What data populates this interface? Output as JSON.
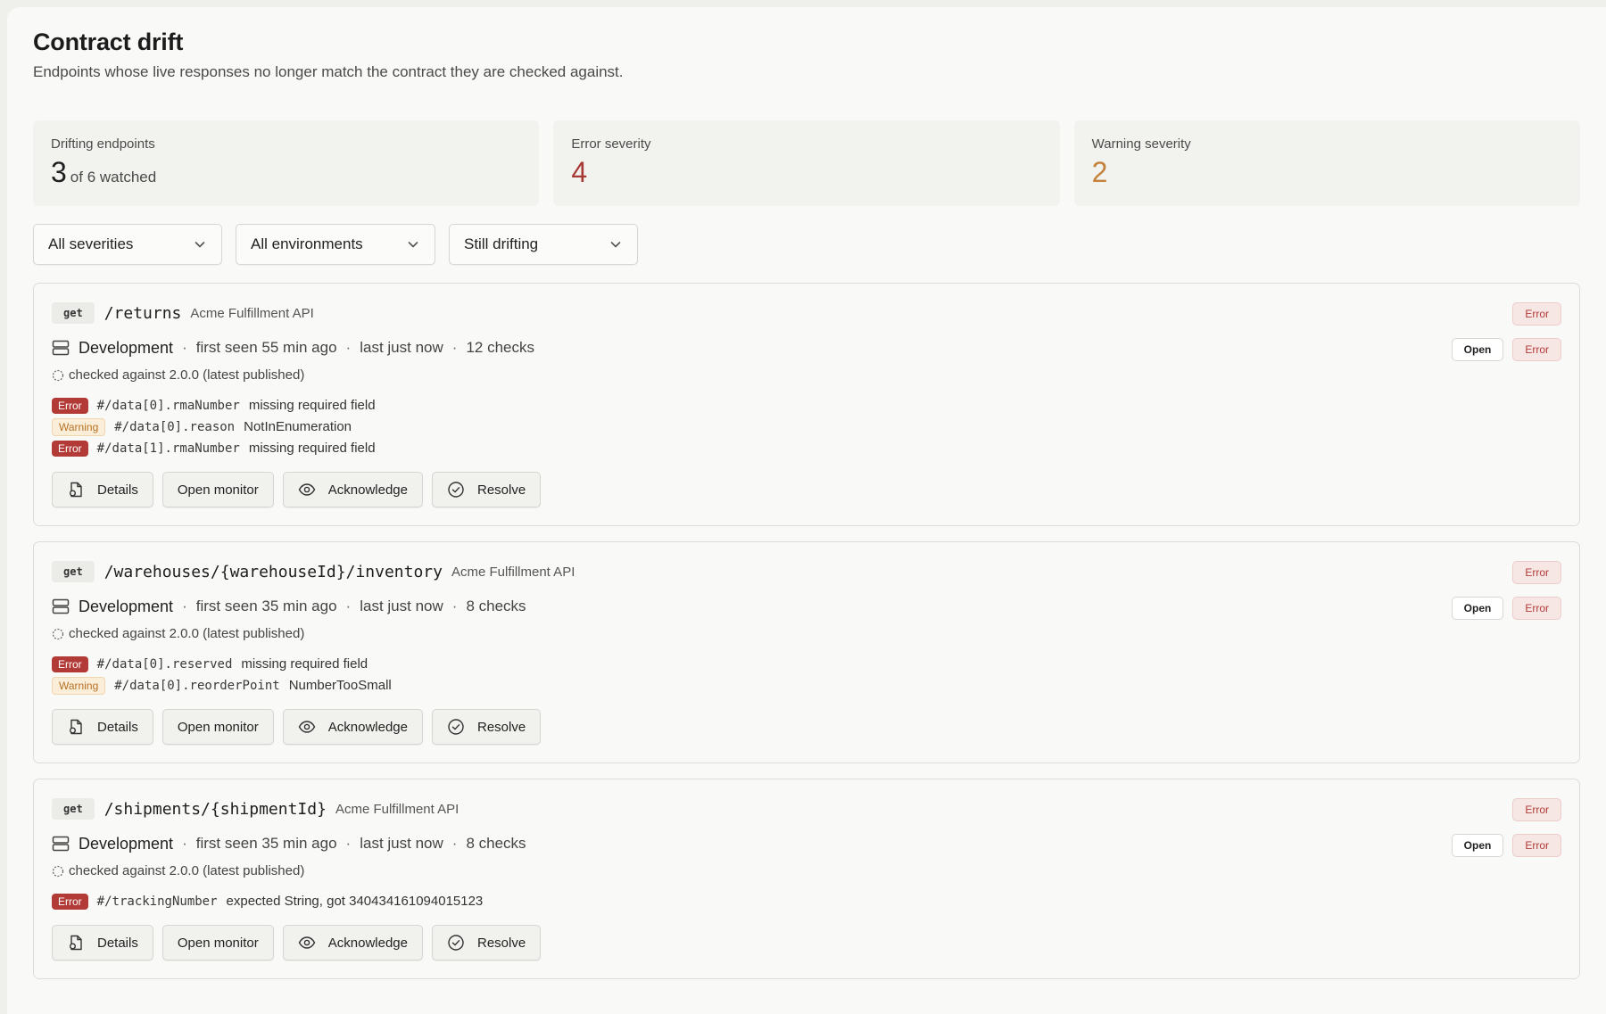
{
  "header": {
    "title": "Contract drift",
    "subtitle": "Endpoints whose live responses no longer match the contract they are checked against."
  },
  "stats": [
    {
      "label": "Drifting endpoints",
      "value": "3",
      "suffix": "of 6 watched",
      "tone": "neutral"
    },
    {
      "label": "Error severity",
      "value": "4",
      "suffix": "",
      "tone": "error"
    },
    {
      "label": "Warning severity",
      "value": "2",
      "suffix": "",
      "tone": "warning"
    }
  ],
  "filters": [
    {
      "selected": "All severities"
    },
    {
      "selected": "All environments"
    },
    {
      "selected": "Still drifting"
    }
  ],
  "actions": {
    "details": "Details",
    "open_monitor": "Open monitor",
    "acknowledge": "Acknowledge",
    "resolve": "Resolve"
  },
  "cards": [
    {
      "method": "get",
      "path": "/returns",
      "api": "Acme Fulfillment API",
      "severity_badge": "Error",
      "status_badge": "Open",
      "status_severity": "Error",
      "environment": "Development",
      "first_seen": "first seen 55 min ago",
      "last_seen": "last just now",
      "checks": "12 checks",
      "checked_against": "checked against 2.0.0 (latest published)",
      "issues": [
        {
          "severity": "Error",
          "pointer": "#/data[0].rmaNumber",
          "message": "missing required field"
        },
        {
          "severity": "Warning",
          "pointer": "#/data[0].reason",
          "message": "NotInEnumeration"
        },
        {
          "severity": "Error",
          "pointer": "#/data[1].rmaNumber",
          "message": "missing required field"
        }
      ]
    },
    {
      "method": "get",
      "path": "/warehouses/{warehouseId}/inventory",
      "api": "Acme Fulfillment API",
      "severity_badge": "Error",
      "status_badge": "Open",
      "status_severity": "Error",
      "environment": "Development",
      "first_seen": "first seen 35 min ago",
      "last_seen": "last just now",
      "checks": "8 checks",
      "checked_against": "checked against 2.0.0 (latest published)",
      "issues": [
        {
          "severity": "Error",
          "pointer": "#/data[0].reserved",
          "message": "missing required field"
        },
        {
          "severity": "Warning",
          "pointer": "#/data[0].reorderPoint",
          "message": "NumberTooSmall"
        }
      ]
    },
    {
      "method": "get",
      "path": "/shipments/{shipmentId}",
      "api": "Acme Fulfillment API",
      "severity_badge": "Error",
      "status_badge": "Open",
      "status_severity": "Error",
      "environment": "Development",
      "first_seen": "first seen 35 min ago",
      "last_seen": "last just now",
      "checks": "8 checks",
      "checked_against": "checked against 2.0.0 (latest published)",
      "issues": [
        {
          "severity": "Error",
          "pointer": "#/trackingNumber",
          "message": "expected String, got 340434161094015123"
        }
      ]
    }
  ],
  "colors": {
    "error": "#b23b37",
    "warning": "#c4823b",
    "background": "#f9f9f7"
  }
}
